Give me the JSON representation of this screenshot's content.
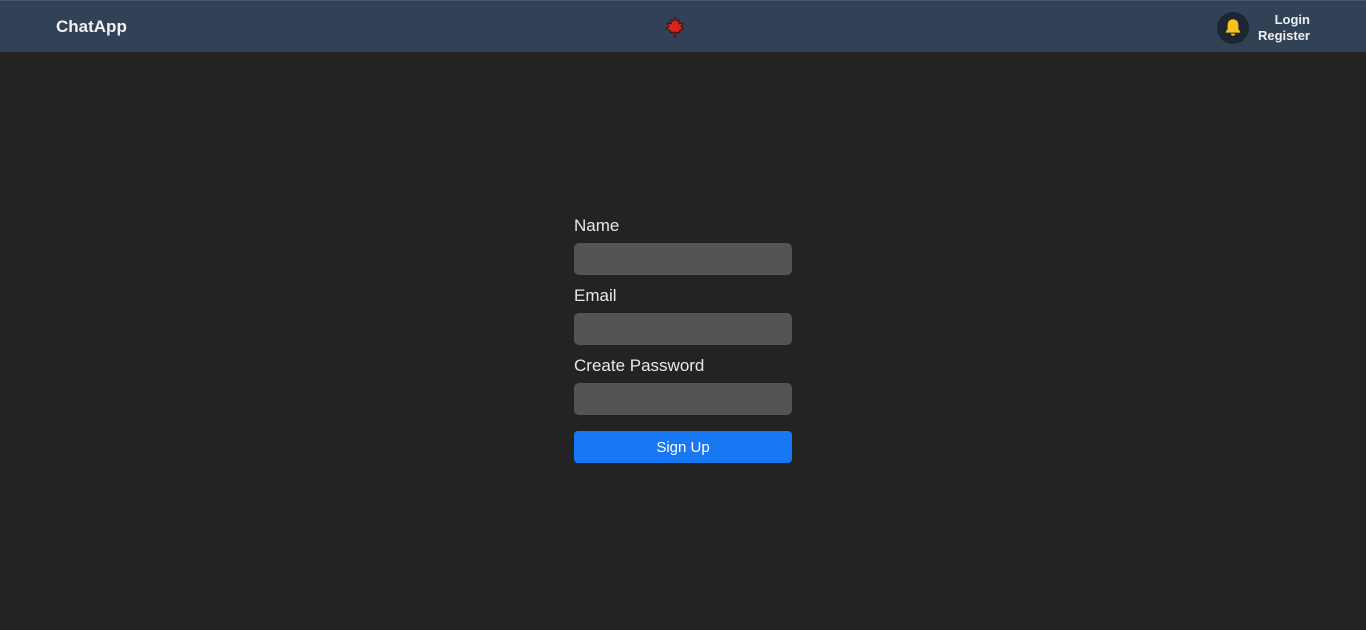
{
  "navbar": {
    "brand": "ChatApp",
    "logo_icon": "maple-leaf-icon",
    "notification_icon": "bell-icon",
    "login_label": "Login",
    "register_label": "Register"
  },
  "signup_form": {
    "name_label": "Name",
    "name_value": "",
    "email_label": "Email",
    "email_value": "",
    "password_label": "Create Password",
    "password_value": "",
    "submit_label": "Sign Up"
  },
  "colors": {
    "navbar_bg": "#324256",
    "page_bg": "#232323",
    "input_bg": "#545454",
    "primary": "#1877f2",
    "bell": "#f7c21b",
    "logo": "#d9261c"
  }
}
